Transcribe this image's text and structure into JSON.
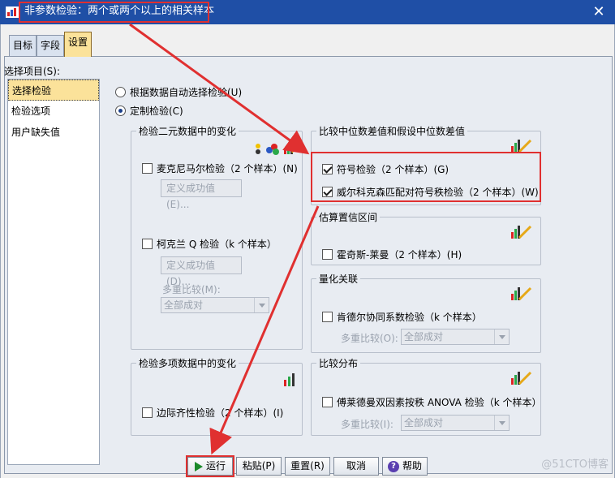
{
  "window": {
    "title": "非参数检验：两个或两个以上的相关样本",
    "close": "✕"
  },
  "tabs": [
    {
      "label": "目标",
      "active": false
    },
    {
      "label": "字段",
      "active": false
    },
    {
      "label": "设置",
      "active": true
    }
  ],
  "select_items": {
    "label": "选择项目(S):",
    "items": [
      "选择检验",
      "检验选项",
      "用户缺失值"
    ],
    "selected": 0
  },
  "mode": {
    "auto": {
      "label": "根据数据自动选择检验(U)",
      "checked": false
    },
    "custom": {
      "label": "定制检验(C)",
      "checked": true
    }
  },
  "binary_group": {
    "title": "检验二元数据中的变化",
    "mcnemar": {
      "label": "麦克尼马尔检验（2 个样本）(N)",
      "checked": false
    },
    "mcnemar_define": "定义成功值(E)...",
    "cochran": {
      "label": "柯克兰 Q 检验（k 个样本）",
      "checked": false
    },
    "cochran_define": "定义成功值(D)...",
    "multiple_label": "多重比较(M):",
    "multiple_value": "全部成对"
  },
  "median_group": {
    "title": "比较中位数差值和假设中位数差值",
    "sign": {
      "label": "符号检验（2 个样本）(G)",
      "checked": true
    },
    "wilcoxon": {
      "label": "威尔科克森匹配对符号秩检验（2 个样本）(W)",
      "checked": true
    }
  },
  "confidence_group": {
    "title": "估算置信区间",
    "hodges": {
      "label": "霍奇斯-莱曼（2 个样本）(H)",
      "checked": false
    }
  },
  "association_group": {
    "title": "量化关联",
    "kendall": {
      "label": "肯德尔协同系数检验（k 个样本）",
      "checked": false
    },
    "multiple_label": "多重比较(O):",
    "multiple_value": "全部成对"
  },
  "multinomial_group": {
    "title": "检验多项数据中的变化",
    "marginal": {
      "label": "边际齐性检验（2 个样本）(I)",
      "checked": false
    }
  },
  "distribution_group": {
    "title": "比较分布",
    "friedman": {
      "label": "傅莱德曼双因素按秩 ANOVA 检验（k 个样本）",
      "checked": false
    },
    "multiple_label": "多重比较(I):",
    "multiple_value": "全部成对"
  },
  "buttons": {
    "run": "运行",
    "paste": "粘贴(P)",
    "reset": "重置(R)",
    "cancel": "取消",
    "help": "帮助"
  },
  "watermark": "@51CTO博客",
  "colors": {
    "titlebar": "#1f4fa6",
    "highlight": "#e03030",
    "selected": "#fbe29a"
  }
}
